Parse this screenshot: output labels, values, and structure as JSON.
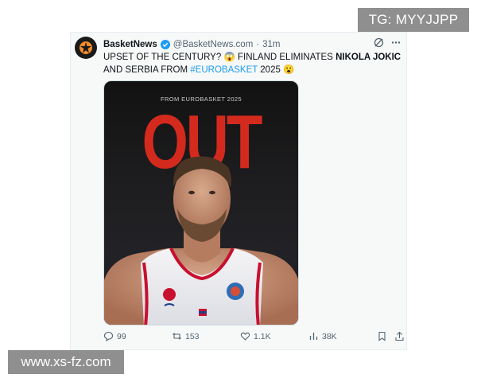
{
  "watermarks": {
    "top": "TG: MYYJJPP",
    "bottom": "www.xs-fz.com"
  },
  "tweet": {
    "display_name": "BasketNews",
    "handle": "@BasketNews.com",
    "separator": "·",
    "time": "31m",
    "text_part1": "UPSET OF THE CENTURY? ",
    "emoji1": "😱",
    "text_part2": " FINLAND ELIMINATES ",
    "text_bold": "NIKOLA JOKIC",
    "text_part3": " AND SERBIA FROM ",
    "hashtag": "#EUROBASKET",
    "text_part4": " 2025 ",
    "emoji2": "😮"
  },
  "media": {
    "subtitle": "FROM EUROBASKET 2025",
    "headline": "OUT"
  },
  "actions": {
    "replies": "99",
    "reposts": "153",
    "likes": "1.1K",
    "views": "38K"
  },
  "icons": {
    "avatar": "basketball-logo-icon",
    "verified": "verified-badge-icon",
    "grok": "grok-icon",
    "more": "more-icon",
    "reply": "reply-icon",
    "repost": "repost-icon",
    "like": "heart-icon",
    "views": "views-icon",
    "bookmark": "bookmark-icon",
    "share": "share-icon"
  },
  "colors": {
    "accent": "#1d9bf0",
    "headline_red": "#d42a1e",
    "serbia_red": "#c8102e"
  }
}
